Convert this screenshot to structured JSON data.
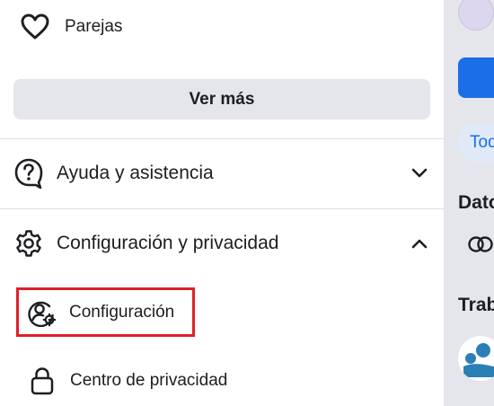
{
  "menu": {
    "parejas_label": "Parejas",
    "ver_mas_label": "Ver más",
    "ayuda_label": "Ayuda y asistencia",
    "config_privacidad_label": "Configuración y privacidad",
    "sub_items": {
      "configuracion_label": "Configuración",
      "centro_privacidad_label": "Centro de privacidad"
    },
    "highlight_color": "#e0202a"
  },
  "background_panel": {
    "pill_text": "Tod",
    "heading_1": "Dato",
    "heading_2": "Trab",
    "accent": "#1b6ee8"
  }
}
